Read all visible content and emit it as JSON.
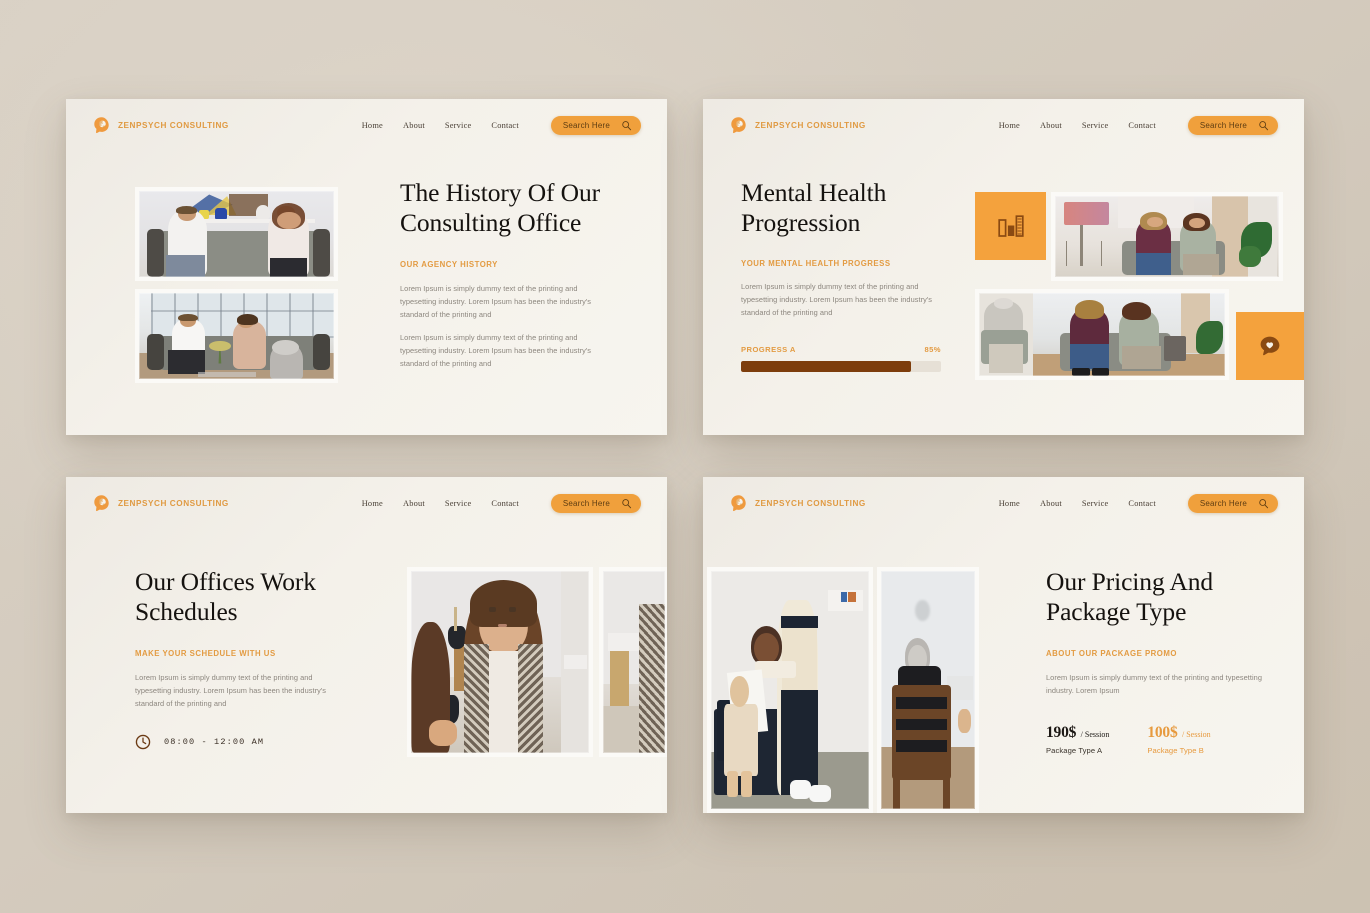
{
  "brand": {
    "name": "ZENPSYCH CONSULTING",
    "logo_icon": "brain-head-icon",
    "color": "#e09a42"
  },
  "nav": {
    "links": [
      "Home",
      "About",
      "Service",
      "Contact"
    ],
    "search": {
      "label": "Search Here",
      "icon": "search-icon",
      "bg": "#f0a03c"
    }
  },
  "theme": {
    "background": "#d4cbbe",
    "card_bg": "#f4f1ea",
    "accent_orange": "#e39b42",
    "tile_orange": "#f4a23d",
    "progress_fill": "#7d3d0c",
    "progress_track": "#e6e0d6",
    "heading": "#15120f",
    "body_text": "#8c867e"
  },
  "slides": [
    {
      "id": "history",
      "title": "The History Of Our Consulting Office",
      "eyebrow": "OUR AGENCY HISTORY",
      "paragraphs": [
        "Lorem Ipsum is simply dummy text of the printing and typesetting industry. Lorem Ipsum has been the industry's standard of the printing and",
        "Lorem Ipsum is simply dummy text of the printing and typesetting industry. Lorem Ipsum has been the industry's standard of the printing and"
      ],
      "media": {
        "layout": "two-stacked-photos",
        "side": "left"
      }
    },
    {
      "id": "progression",
      "title": "Mental Health Progression",
      "eyebrow": "YOUR MENTAL HEALTH PROGRESS",
      "paragraphs": [
        "Lorem Ipsum is simply dummy text of the printing and typesetting industry. Lorem Ipsum has been the industry's standard of the printing and"
      ],
      "progress": {
        "label": "PROGRESS A",
        "percent_label": "85%",
        "percent": 85
      },
      "media": {
        "layout": "collage-with-tiles",
        "side": "right",
        "tiles": [
          "bar-chart-icon",
          "heart-chat-icon"
        ]
      }
    },
    {
      "id": "schedules",
      "title": "Our Offices Work Schedules",
      "eyebrow": "MAKE YOUR SCHEDULE WITH US",
      "paragraphs": [
        "Lorem Ipsum is simply dummy text of the printing and typesetting industry. Lorem Ipsum has been the industry's standard of the printing and"
      ],
      "schedule": {
        "icon": "clock-icon",
        "hours": "08:00 - 12:00 AM"
      },
      "media": {
        "layout": "wide-photo-pair",
        "side": "right"
      }
    },
    {
      "id": "pricing",
      "title": "Our Pricing And Package Type",
      "eyebrow": "ABOUT OUR PACKAGE PROMO",
      "paragraphs": [
        "Lorem Ipsum is simply dummy text of the printing and typesetting industry. Lorem Ipsum"
      ],
      "packages": [
        {
          "amount": "190$",
          "unit": "/ Session",
          "name": "Package Type A",
          "highlight": false
        },
        {
          "amount": "100$",
          "unit": "/ Session",
          "name": "Package Type B",
          "highlight": true
        }
      ],
      "media": {
        "layout": "two-vertical-photos",
        "side": "left"
      }
    }
  ]
}
